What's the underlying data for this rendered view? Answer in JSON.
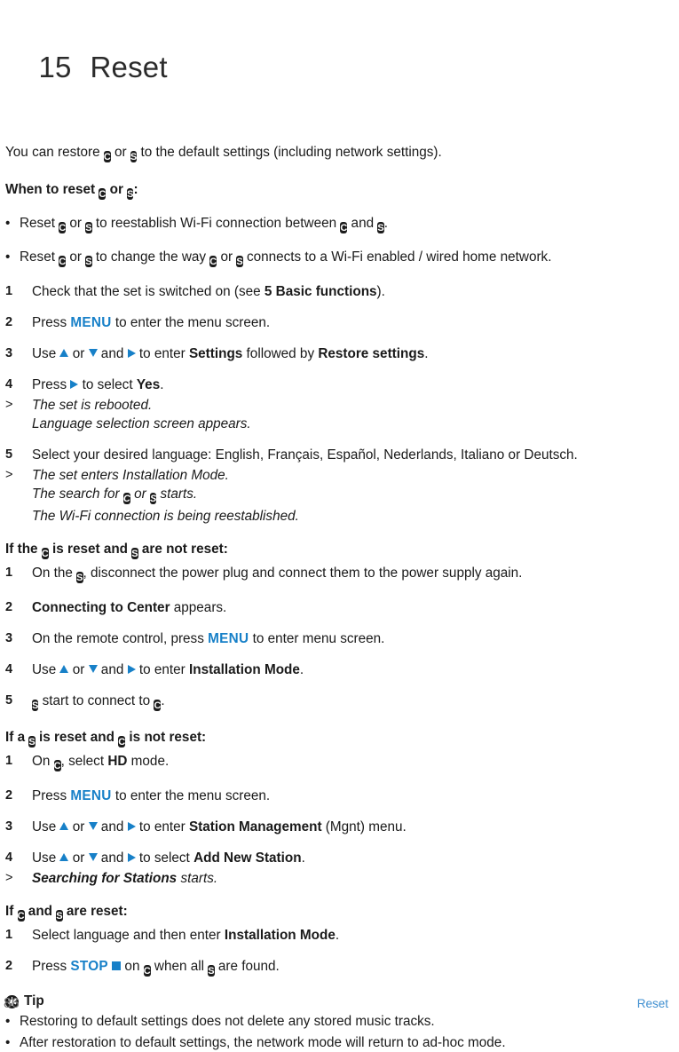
{
  "colors": {
    "accent_blue": "#1780c8",
    "footer_blue": "#3f8fd0",
    "icon_dark": "#1c1c1c",
    "text": "#1a1a1a",
    "page_number_gray": "#7a7a7a"
  },
  "header": {
    "chapter_number": "15",
    "chapter_title": "Reset"
  },
  "icons": {
    "center_label": "C",
    "station_label": "S",
    "tip_icon": "asterisk-circle-icon",
    "up_arrow": "triangle-up-icon",
    "down_arrow": "triangle-down-icon",
    "right_arrow": "triangle-right-icon",
    "stop_square": "stop-square-icon"
  },
  "intro": {
    "part1": "You can restore ",
    "or": " or ",
    "part2": " to the default settings (including network settings)."
  },
  "when_to_reset": {
    "prefix": "When to reset ",
    "or": " or ",
    "suffix": ":",
    "bullets": [
      {
        "dot": "•",
        "p1": "Reset ",
        "p2": " or ",
        "p3": " to reestablish Wi-Fi connection between ",
        "p4": " and ",
        "p5": "."
      },
      {
        "dot": "•",
        "p1": "Reset ",
        "p2": " or ",
        "p3": " to change the way ",
        "p4": " or ",
        "p5": " connects to a Wi-Fi enabled / wired home network."
      }
    ]
  },
  "main_steps": [
    {
      "num": "1",
      "pre": "Check that the set is switched on (see ",
      "bold": "5 Basic functions",
      "post": ")."
    },
    {
      "num": "2",
      "pre": "Press ",
      "blue": "MENU",
      "post": " to enter the menu screen."
    },
    {
      "num": "3",
      "pre": "Use ",
      "mid1": " or ",
      "mid2": " and ",
      "mid3": " to enter ",
      "bold1": "Settings",
      "mid4": " followed by ",
      "bold2": "Restore settings",
      "post": "."
    },
    {
      "num": "4",
      "pre": "Press ",
      "mid": " to select ",
      "bold": "Yes",
      "post": "."
    }
  ],
  "result_after_4": {
    "marker": ">",
    "lines": [
      "The set is rebooted.",
      "Language selection screen appears."
    ]
  },
  "step_5": {
    "num": "5",
    "text": "Select your desired language: English, Français, Español, Nederlands, Italiano or Deutsch."
  },
  "result_after_5": {
    "marker": ">",
    "line1": "The set enters Installation Mode.",
    "line2_pre": "The search for ",
    "line2_mid": " or ",
    "line2_post": " starts.",
    "line3": "The Wi-Fi connection is being reestablished."
  },
  "section_c_reset": {
    "head_p1": "If the ",
    "head_p2": " is reset and ",
    "head_p3": " are not reset:",
    "steps": [
      {
        "num": "1",
        "pre": "On the ",
        "post": ", disconnect the power plug and connect them to the power supply again."
      },
      {
        "num": "2",
        "bold": "Connecting to Center",
        "post": " appears."
      },
      {
        "num": "3",
        "pre": "On the remote control, press ",
        "blue": "MENU",
        "post": " to enter menu screen."
      },
      {
        "num": "4",
        "pre": "Use ",
        "mid1": " or ",
        "mid2": " and ",
        "mid3": " to enter ",
        "bold": "Installation Mode",
        "post": "."
      },
      {
        "num": "5",
        "pre": " start to connect to ",
        "post": "."
      }
    ]
  },
  "section_s_reset": {
    "head_p1": "If a ",
    "head_p2": " is reset and ",
    "head_p3": " is not reset:",
    "steps": [
      {
        "num": "1",
        "pre": "On ",
        "mid": ", select ",
        "bold": "HD",
        "post": " mode."
      },
      {
        "num": "2",
        "pre": "Press ",
        "blue": "MENU",
        "post": " to enter the menu screen."
      },
      {
        "num": "3",
        "pre": "Use ",
        "mid1": " or ",
        "mid2": " and ",
        "mid3": " to enter ",
        "bold": "Station Management",
        "post": " (Mgnt) menu."
      },
      {
        "num": "4",
        "pre": "Use ",
        "mid1": " or ",
        "mid2": " and ",
        "mid3": " to select ",
        "bold": "Add New Station",
        "post": "."
      }
    ],
    "result": {
      "marker": ">",
      "bold": "Searching for Stations",
      "post": " starts."
    }
  },
  "section_both_reset": {
    "head_p1": "If ",
    "head_p2": " and ",
    "head_p3": " are reset:",
    "steps": [
      {
        "num": "1",
        "pre": "Select language and then enter ",
        "bold": "Installation Mode",
        "post": "."
      },
      {
        "num": "2",
        "pre": "Press ",
        "blue": "STOP",
        "mid": " on ",
        "mid2": " when all ",
        "post": " are found."
      }
    ]
  },
  "tip": {
    "title": "Tip",
    "bullets": [
      {
        "dot": "•",
        "text": "Restoring to default settings does not delete any stored music tracks."
      },
      {
        "dot": "•",
        "text": "After restoration to default settings, the network mode will return to ad-hoc mode."
      }
    ]
  },
  "footer": {
    "page_number": "86",
    "section_name": "Reset"
  }
}
